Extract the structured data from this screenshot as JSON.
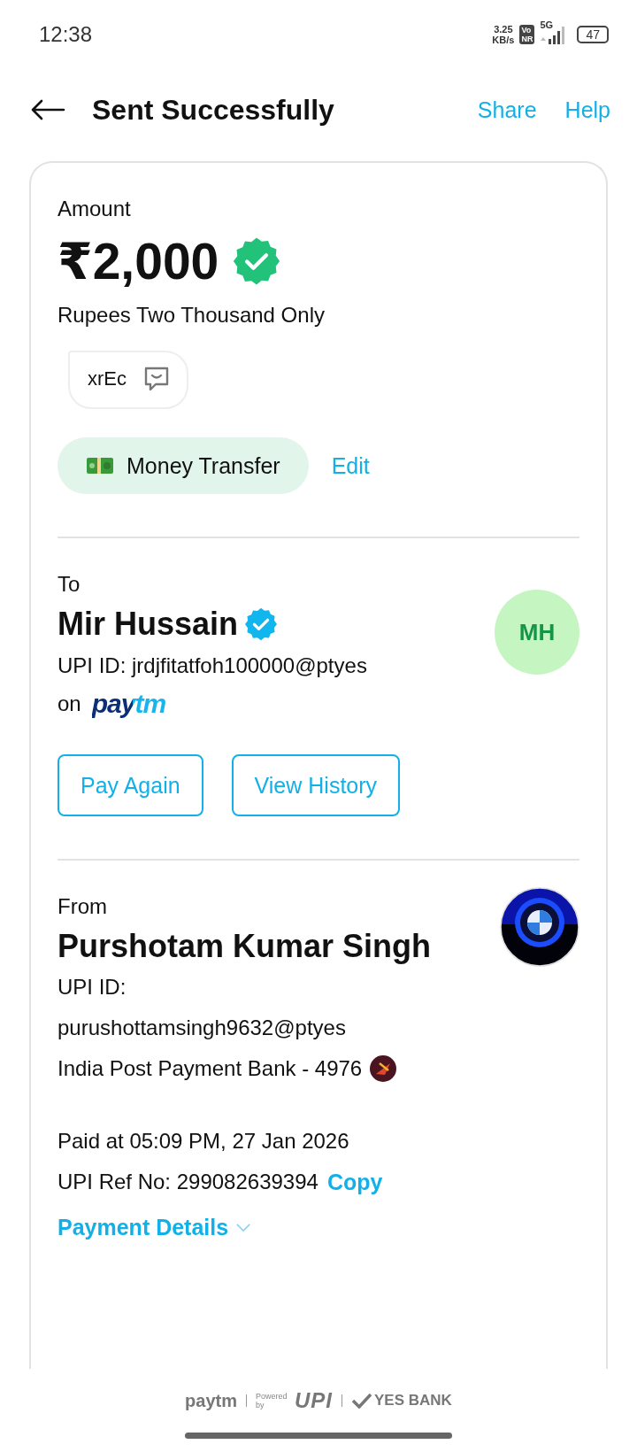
{
  "status_bar": {
    "time": "12:38",
    "net_speed": "3.25",
    "net_unit": "KB/s",
    "volte_top": "Vo",
    "volte_bottom": "NR",
    "network": "5G",
    "battery": "47"
  },
  "header": {
    "title": "Sent Successfully",
    "actions": [
      "Share",
      "Help"
    ]
  },
  "amount": {
    "label": "Amount",
    "value": "₹2,000",
    "in_words": "Rupees Two Thousand Only",
    "note": "xrEc",
    "category": "Money Transfer",
    "edit": "Edit"
  },
  "to": {
    "label": "To",
    "name": "Mir Hussain",
    "upi": "UPI ID: jrdjfitatfoh100000@ptyes",
    "app_prefix": "on",
    "app": "paytm",
    "initials": "MH",
    "buttons": [
      "Pay Again",
      "View History"
    ]
  },
  "from": {
    "label": "From",
    "name": "Purshotam Kumar Singh",
    "upi_label": "UPI ID:",
    "upi": "purushottamsingh9632@ptyes",
    "bank": "India Post Payment Bank - 4976"
  },
  "transaction": {
    "paid_at": "Paid at 05:09 PM, 27 Jan 2026",
    "ref": "UPI Ref No: 299082639394",
    "copy": "Copy",
    "details": "Payment Details"
  },
  "footer": {
    "brand": "paytm",
    "powered": "Powered by",
    "upi": "UPI",
    "bank": "YES BANK"
  }
}
